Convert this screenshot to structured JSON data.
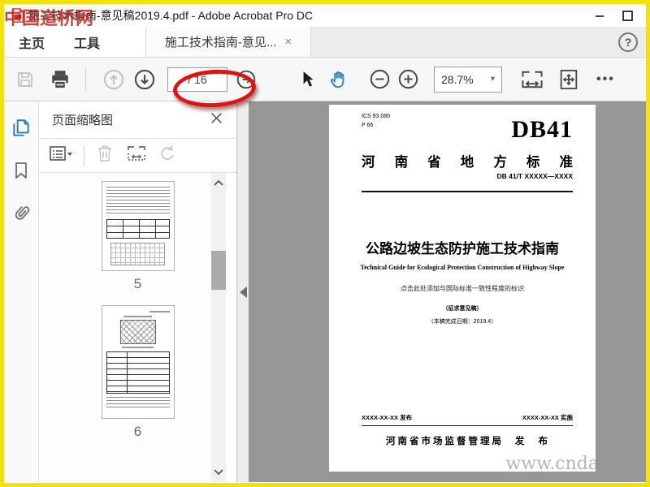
{
  "window": {
    "title": "施工技术指南-意见稿2019.4.pdf - Adobe Acrobat Pro DC"
  },
  "watermarks": {
    "top_left": "中国道桥网",
    "bottom_right": "www.cnda"
  },
  "tabs": {
    "home": "主页",
    "tools": "工具",
    "document": "施工技术指南-意见...",
    "document_close": "×",
    "help": "?"
  },
  "toolbar": {
    "page_total": "/ 16",
    "zoom_level": "28.7%",
    "zoom_caret": "▾",
    "more_options": "•••"
  },
  "sidebar": {
    "panel_title": "页面缩略图",
    "thumbnails": [
      {
        "page": "5"
      },
      {
        "page": "6"
      }
    ]
  },
  "document": {
    "ics_line": "ICS  93.080",
    "p_line": "P 66",
    "code_big": "DB41",
    "standard_name": "河南省地方标准",
    "doc_number": "DB 41/T XXXXX—XXXX",
    "title_cn": "公路边坡生态防护施工技术指南",
    "title_en": "Technical Guide for Ecological Protection Construction of Highway Slope",
    "note_intl": "点击此处添加与国际标准一致性程度的标识",
    "note_draft": "（征求意见稿）",
    "note_date": "（本稿完成日期：2019.4）",
    "issue_date": "XXXX-XX-XX 发布",
    "impl_date": "XXXX-XX-XX 实施",
    "issuer": "河南省市场监督管理局",
    "publish": "发 布"
  }
}
